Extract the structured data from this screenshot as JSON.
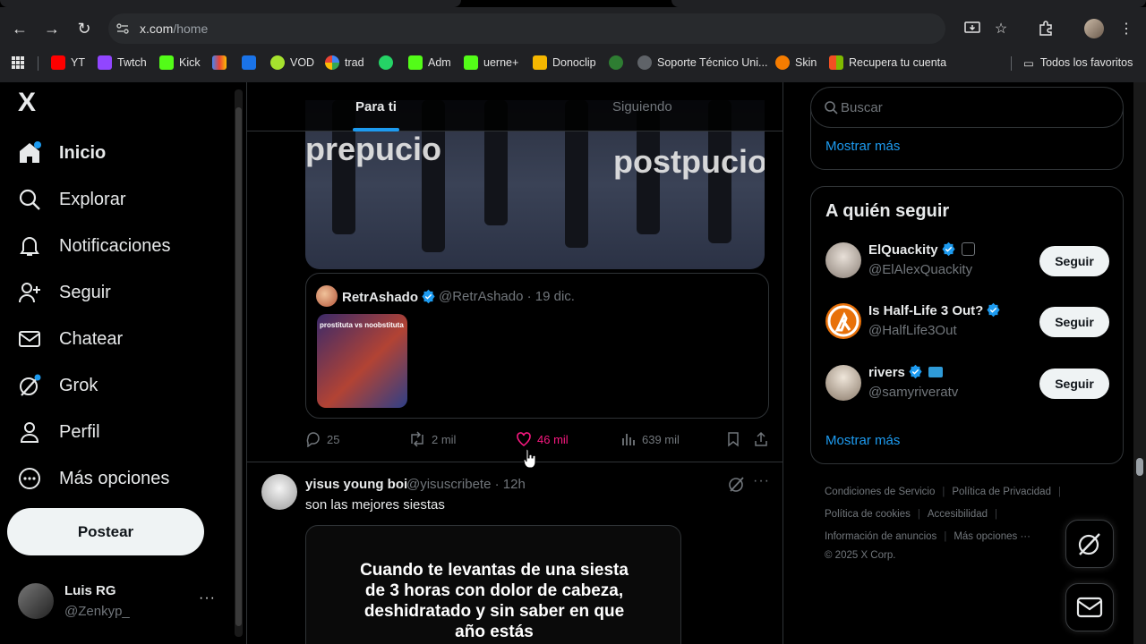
{
  "browser": {
    "url_host": "x.com",
    "url_path": "/home",
    "bookmarks": [
      "YT",
      "Twtch",
      "Kick",
      "",
      "",
      "VOD",
      "trad",
      "",
      "Adm",
      "uerne+",
      "Donoclip",
      "",
      "Soporte Técnico Uni...",
      "Skin",
      "Recupera tu cuenta"
    ],
    "all_bookmarks": "Todos los favoritos"
  },
  "sidebar": {
    "logo": "X",
    "items": [
      {
        "label": "Inicio",
        "icon": "home-icon"
      },
      {
        "label": "Explorar",
        "icon": "search-icon"
      },
      {
        "label": "Notificaciones",
        "icon": "bell-icon"
      },
      {
        "label": "Seguir",
        "icon": "follow-icon"
      },
      {
        "label": "Chatear",
        "icon": "mail-icon"
      },
      {
        "label": "Grok",
        "icon": "grok-icon"
      },
      {
        "label": "Perfil",
        "icon": "person-icon"
      },
      {
        "label": "Más opciones",
        "icon": "more-circle-icon"
      }
    ],
    "post_button": "Postear",
    "account": {
      "name": "Luis RG",
      "handle": "@Zenkyp_",
      "more": "···"
    }
  },
  "feed": {
    "tabs": [
      "Para ti",
      "Siguiendo"
    ],
    "post1": {
      "media_text_left": "prepucio",
      "media_text_right": "postpucio",
      "quote": {
        "name": "RetrAshado",
        "handle": "@RetrAshado · 19 dic.",
        "image_caption": "prostituta vs noobstituta"
      },
      "actions": {
        "replies": "25",
        "reposts": "2 mil",
        "likes": "46 mil",
        "views": "639 mil"
      }
    },
    "post2": {
      "name": "yisus young boi",
      "handle": "@yisuscribete · 12h",
      "text": "son las mejores siestas",
      "more": "···",
      "meme_lines": [
        "Cuando te levantas de una siesta",
        "de 3 horas con dolor de cabeza,",
        "deshidratado y sin saber en que",
        "año estás"
      ]
    }
  },
  "right": {
    "search_placeholder": "Buscar",
    "show_more": "Mostrar más",
    "who_to_follow_title": "A quién seguir",
    "follow_label": "Seguir",
    "suggestions": [
      {
        "name": "ElQuackity",
        "handle": "@ElAlexQuackity"
      },
      {
        "name": "Is Half-Life 3 Out?",
        "handle": "@HalfLife3Out"
      },
      {
        "name": "rivers",
        "handle": "@samyriveratv"
      }
    ],
    "show_more_2": "Mostrar más",
    "footer": [
      "Condiciones de Servicio",
      "Política de Privacidad",
      "Política de cookies",
      "Accesibilidad",
      "Información de anuncios",
      "Más opciones ···",
      "© 2025 X Corp."
    ]
  },
  "colors": {
    "accent": "#1d9bf0",
    "like": "#f91880",
    "bg": "#000000",
    "border": "#2f3336"
  }
}
